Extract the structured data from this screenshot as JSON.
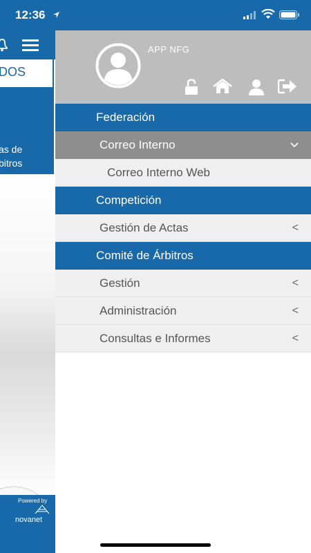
{
  "status_bar": {
    "time": "12:36"
  },
  "background": {
    "tab_label": "DOS",
    "card_line1": "as de",
    "card_line2": "bitros",
    "footer_powered": "Powered by",
    "footer_brand": "novanet"
  },
  "drawer": {
    "app_name": "APP NFG",
    "header_icons": [
      "unlock-icon",
      "home-icon",
      "user-icon",
      "logout-icon"
    ],
    "menu": [
      {
        "type": "section",
        "label": "Federación"
      },
      {
        "type": "active",
        "label": "Correo Interno",
        "chevron": "⌄"
      },
      {
        "type": "sub",
        "label": "Correo Interno Web"
      },
      {
        "type": "section",
        "label": "Competición"
      },
      {
        "type": "item",
        "label": "Gestión de Actas",
        "chevron": "<"
      },
      {
        "type": "section",
        "label": "Comité de Árbitros"
      },
      {
        "type": "item",
        "label": "Gestión",
        "chevron": "<"
      },
      {
        "type": "item",
        "label": "Administración",
        "chevron": "<"
      },
      {
        "type": "item",
        "label": "Consultas e Informes",
        "chevron": "<"
      }
    ]
  },
  "colors": {
    "primary_blue": "#1769aa",
    "header_gray": "#bdbdbd",
    "active_gray": "#8e8e8e",
    "item_bg": "#efefef"
  }
}
